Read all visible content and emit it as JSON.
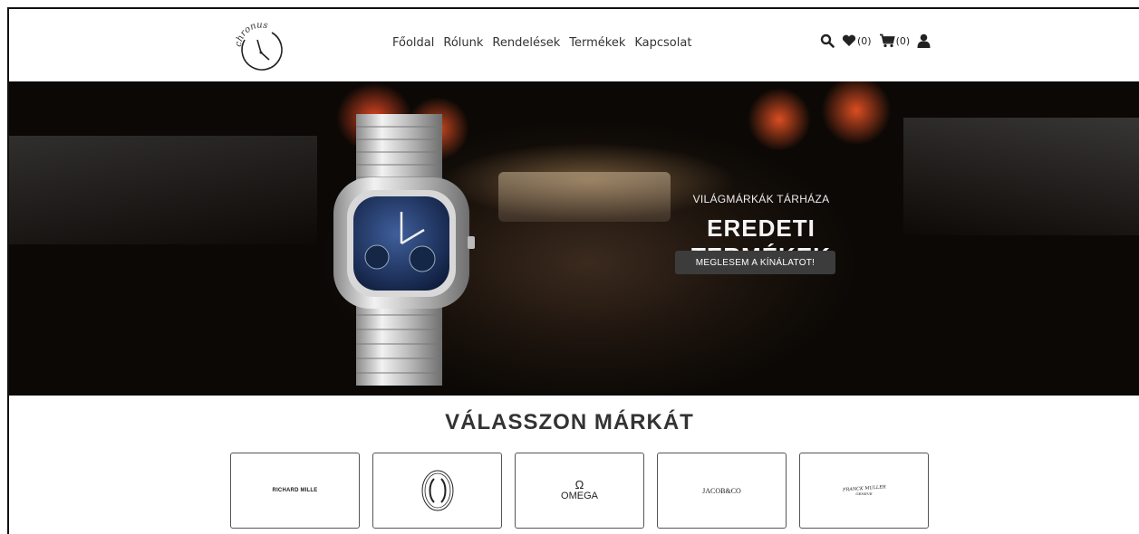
{
  "header": {
    "logo_text": "chronus",
    "nav": [
      "Főoldal",
      "Rólunk",
      "Rendelések",
      "Termékek",
      "Kapcsolat"
    ],
    "icons": {
      "search": "search-icon",
      "wishlist": "heart-icon",
      "cart": "cart-icon",
      "account": "user-icon"
    },
    "wishlist_count": "(0)",
    "cart_count": "(0)"
  },
  "hero": {
    "subtitle": "VILÁGMÁRKÁK TÁRHÁZA",
    "title": "EREDETI TERMÉKEK",
    "button": "MEGLESEM A KÍNÁLATOT!"
  },
  "brands": {
    "title": "VÁLASSZON MÁRKÁT",
    "items": [
      {
        "name": "RICHARD MILLE"
      },
      {
        "name": "Cartier"
      },
      {
        "symbol": "Ω",
        "name": "OMEGA"
      },
      {
        "name": "JACOB&CO"
      },
      {
        "name": "FRANCK MULLER",
        "sub": "GENEVE"
      }
    ]
  },
  "colors": {
    "button_bg": "#3c3c3c",
    "text_dark": "#333333",
    "hero_text": "#f5f5f5"
  }
}
